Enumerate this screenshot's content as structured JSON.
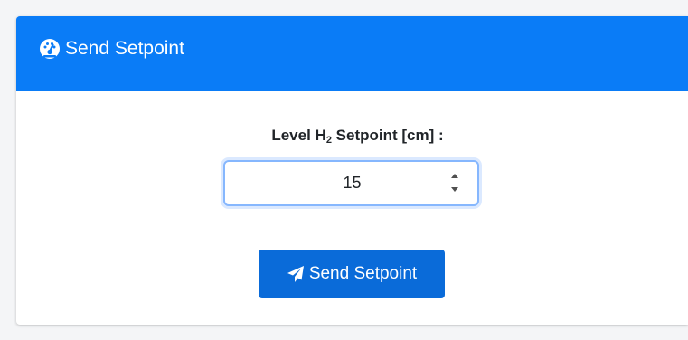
{
  "card": {
    "title": "Send Setpoint",
    "header_icon": "tachometer-icon",
    "header_color": "#0a7cf7"
  },
  "form": {
    "label_prefix": "Level H",
    "label_subscript": "2",
    "label_suffix": " Setpoint [cm] :",
    "setpoint_value": "15"
  },
  "button": {
    "label": "Send Setpoint",
    "icon": "paper-plane-icon",
    "color": "#0a6bd9"
  }
}
